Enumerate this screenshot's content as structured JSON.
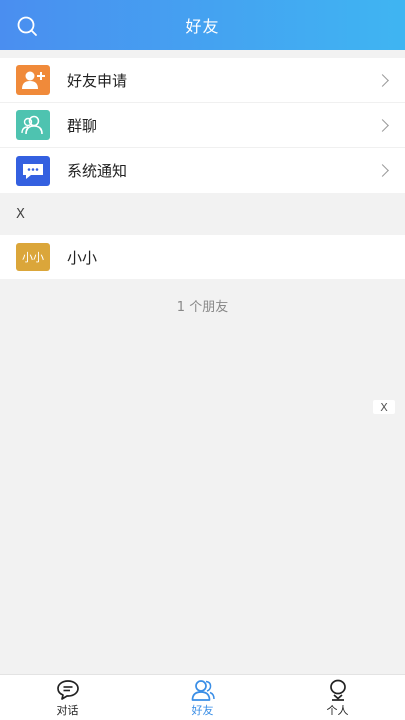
{
  "header": {
    "title": "好友",
    "search_icon": "search-icon"
  },
  "menu": [
    {
      "label": "好友申请",
      "icon": "add-user-icon",
      "color": "#f08a3a"
    },
    {
      "label": "群聊",
      "icon": "group-icon",
      "color": "#4ec3b0"
    },
    {
      "label": "系统通知",
      "icon": "message-icon",
      "color": "#3460e0"
    }
  ],
  "section": {
    "letter": "X"
  },
  "friends": [
    {
      "avatar_text": "小小",
      "name": "小小",
      "avatar_color": "#dba63a"
    }
  ],
  "friend_count": "1 个朋友",
  "index_bubble": "X",
  "tabs": [
    {
      "label": "对话",
      "icon": "chat-icon",
      "active": false
    },
    {
      "label": "好友",
      "icon": "friends-icon",
      "active": true
    },
    {
      "label": "个人",
      "icon": "person-icon",
      "active": false
    }
  ],
  "colors": {
    "accent": "#3a8ee6",
    "header_start": "#4a8ef0",
    "header_end": "#3fb5f2"
  }
}
